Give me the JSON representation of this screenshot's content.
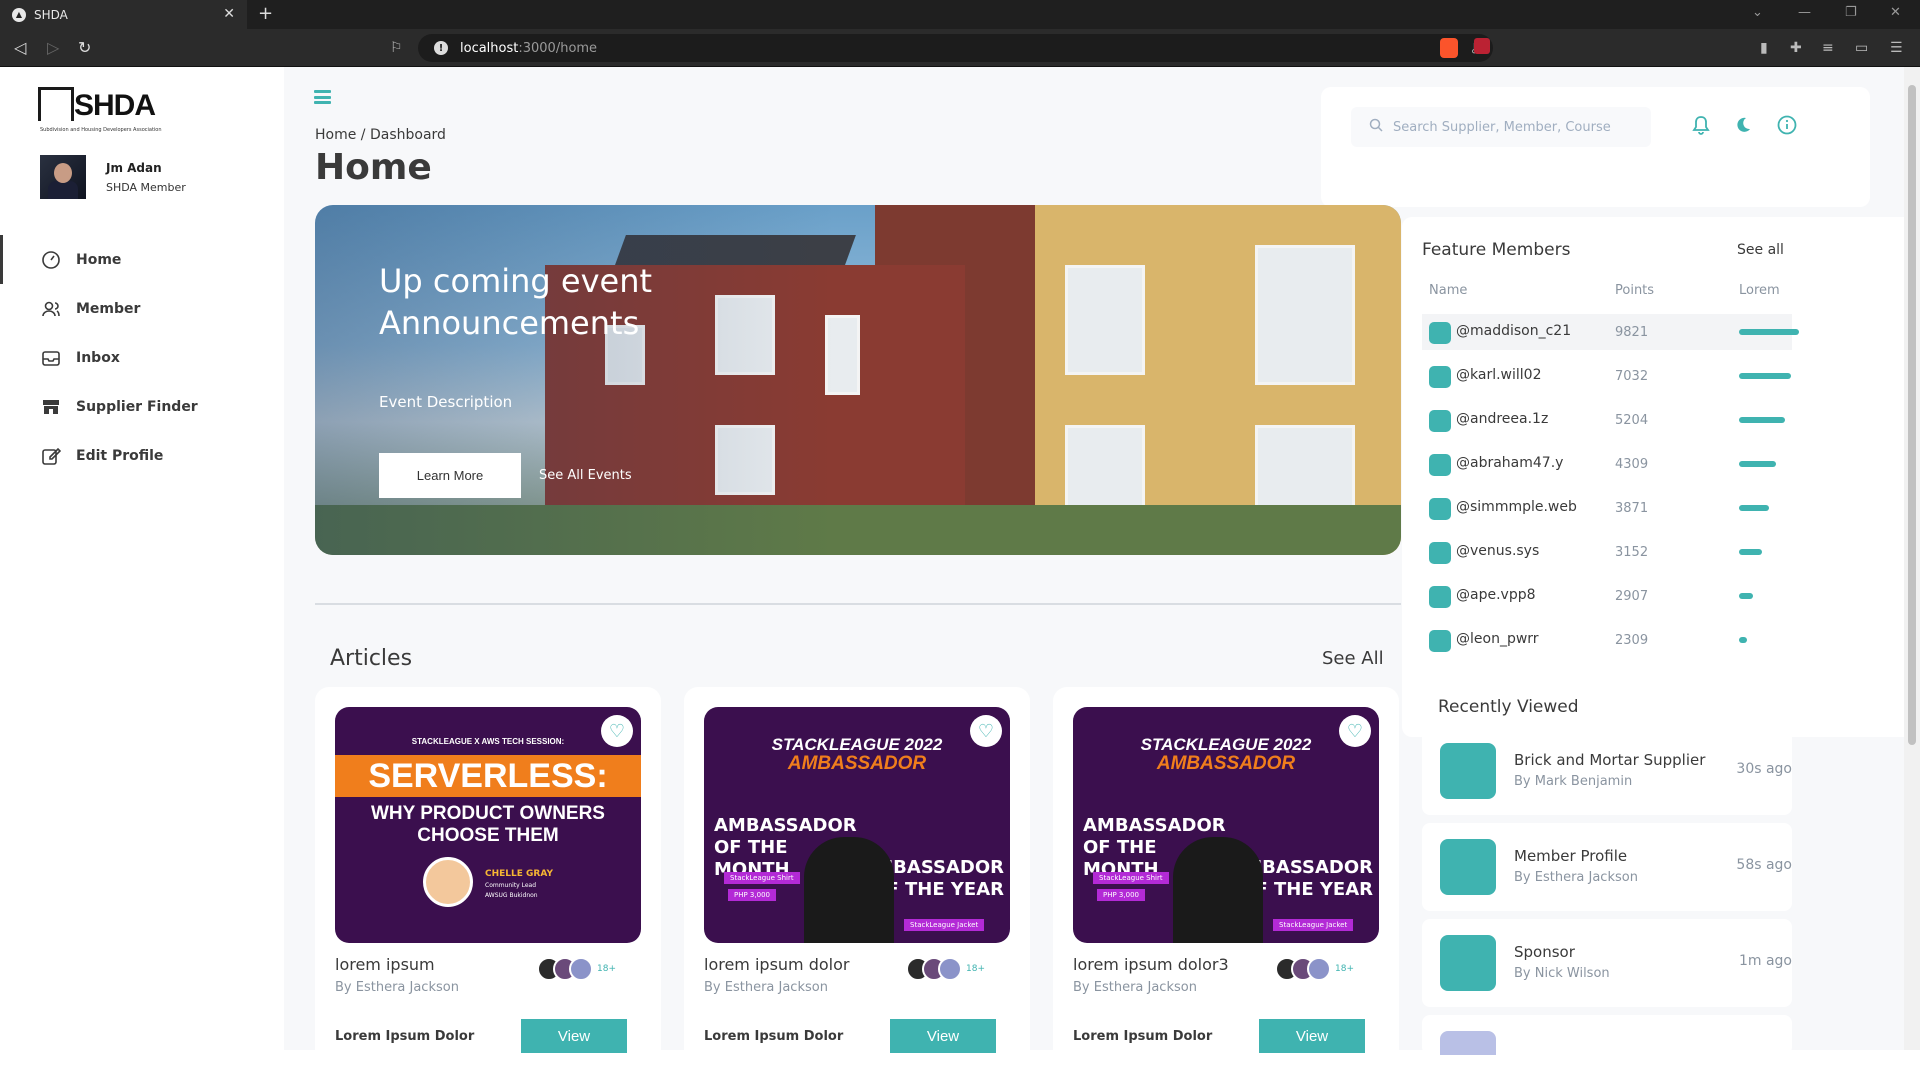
{
  "browser": {
    "tab_title": "SHDA",
    "url_host": "localhost",
    "url_path": ":3000/home"
  },
  "sidebar": {
    "logo_text": "SHDA",
    "logo_tagline": "Subdivision and Housing Developers Association",
    "profile": {
      "name": "Jm Adan",
      "role": "SHDA Member"
    },
    "items": [
      {
        "label": "Home",
        "icon": "gauge-icon",
        "active": true
      },
      {
        "label": "Member",
        "icon": "users-icon",
        "active": false
      },
      {
        "label": "Inbox",
        "icon": "inbox-icon",
        "active": false
      },
      {
        "label": "Supplier Finder",
        "icon": "store-icon",
        "active": false
      },
      {
        "label": "Edit Profile",
        "icon": "edit-icon",
        "active": false
      }
    ]
  },
  "header": {
    "breadcrumb": "Home / Dashboard",
    "title": "Home",
    "search_placeholder": "Search Supplier, Member, Course"
  },
  "hero": {
    "title_line1": "Up coming event",
    "title_line2": "Announcements",
    "description": "Event Description",
    "learn_more": "Learn More",
    "see_all_events": "See All Events"
  },
  "articles": {
    "title": "Articles",
    "see_all": "See All",
    "cards": [
      {
        "title": "lorem ipsum",
        "author": "By Esthera Jackson",
        "label": "Lorem Ipsum Dolor",
        "view": "View",
        "count": "18+",
        "img_top": "STACKLEAGUE X AWS TECH SESSION:",
        "img_big": "SERVERLESS:",
        "img_sub1": "WHY PRODUCT OWNERS",
        "img_sub2": "CHOOSE THEM",
        "img_person": "CHELLE GRAY",
        "img_person_role": "Community Lead",
        "img_person_org": "AWSUG Bukidnon"
      },
      {
        "title": "lorem ipsum dolor",
        "author": "By Esthera Jackson",
        "label": "Lorem Ipsum Dolor",
        "view": "View",
        "count": "18+",
        "img_top": "STACKLEAGUE 2022",
        "img_big": "AMBASSADOR",
        "img_sub1": "AMBASSADOR OF THE MONTH",
        "img_sub2": "AMBASSADOR OF THE YEAR",
        "img_person": "StackLeague Shirt",
        "img_person_role": "PHP 3,000",
        "img_person_org": "StackLeague Jacket"
      },
      {
        "title": "lorem ipsum dolor3",
        "author": "By Esthera Jackson",
        "label": "Lorem Ipsum Dolor",
        "view": "View",
        "count": "18+",
        "img_top": "STACKLEAGUE 2022",
        "img_big": "AMBASSADOR",
        "img_sub1": "AMBASSADOR OF THE MONTH",
        "img_sub2": "AMBASSADOR OF THE YEAR",
        "img_person": "StackLeague Shirt",
        "img_person_role": "PHP 3,000",
        "img_person_org": "StackLeague Jacket"
      }
    ]
  },
  "feature_members": {
    "title": "Feature Members",
    "see_all": "See all",
    "headers": {
      "name": "Name",
      "points": "Points",
      "lorem": "Lorem"
    },
    "rows": [
      {
        "name": "@maddison_c21",
        "points": "9821",
        "bar_fraction": 1.0
      },
      {
        "name": "@karl.will02",
        "points": "7032",
        "bar_fraction": 0.86
      },
      {
        "name": "@andreea.1z",
        "points": "5204",
        "bar_fraction": 0.76
      },
      {
        "name": "@abraham47.y",
        "points": "4309",
        "bar_fraction": 0.62
      },
      {
        "name": "@simmmple.web",
        "points": "3871",
        "bar_fraction": 0.5
      },
      {
        "name": "@venus.sys",
        "points": "3152",
        "bar_fraction": 0.38
      },
      {
        "name": "@ape.vpp8",
        "points": "2907",
        "bar_fraction": 0.24
      },
      {
        "name": "@leon_pwrr",
        "points": "2309",
        "bar_fraction": 0.12
      }
    ]
  },
  "recently_viewed": {
    "title": "Recently Viewed",
    "items": [
      {
        "name": "Brick and Mortar Supplier",
        "by": "By Mark Benjamin",
        "time": "30s ago"
      },
      {
        "name": "Member Profile",
        "by": "By Esthera Jackson",
        "time": "58s ago"
      },
      {
        "name": "Sponsor",
        "by": "By Nick Wilson",
        "time": "1m ago"
      }
    ]
  },
  "colors": {
    "accent": "#3fb3b0",
    "text": "#3a3a3a"
  }
}
